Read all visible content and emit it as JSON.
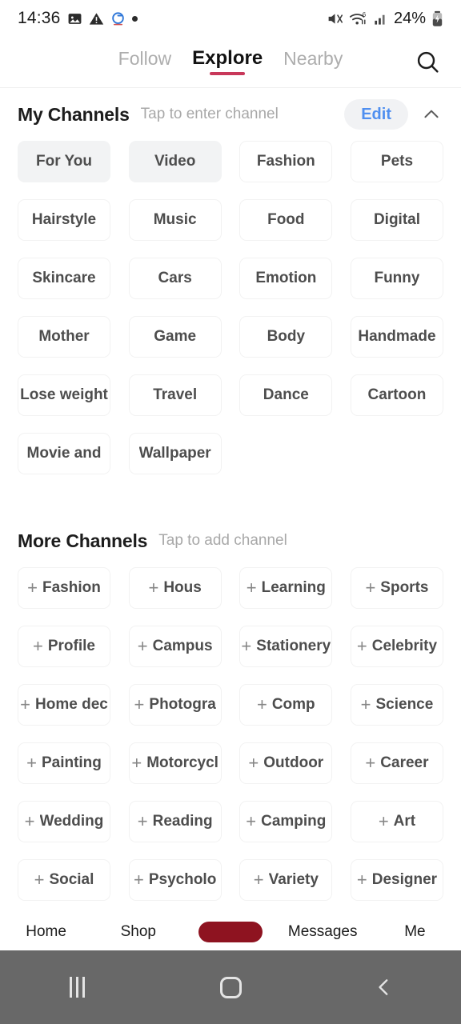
{
  "status_bar": {
    "time": "14:36",
    "battery_percent": "24%",
    "left_icons": [
      "image-icon",
      "warning-icon",
      "sync-icon",
      "dot-icon"
    ],
    "right_icons": [
      "volume-mute-icon",
      "wifi-icon",
      "signal-icon",
      "battery-charging-icon"
    ]
  },
  "top_nav": {
    "tabs": [
      {
        "label": "Follow",
        "active": false
      },
      {
        "label": "Explore",
        "active": true
      },
      {
        "label": "Nearby",
        "active": false
      }
    ],
    "search_icon": "search-icon",
    "active_underline_color": "#c8385a"
  },
  "my_channels": {
    "title": "My Channels",
    "subtitle": "Tap to enter channel",
    "edit_label": "Edit",
    "edit_color": "#4f8ff0",
    "collapse_icon": "chevron-up-icon",
    "items": [
      {
        "label": "For You",
        "selected": true
      },
      {
        "label": "Video",
        "selected": true
      },
      {
        "label": "Fashion",
        "selected": false
      },
      {
        "label": "Pets",
        "selected": false
      },
      {
        "label": "Hairstyle",
        "selected": false
      },
      {
        "label": "Music",
        "selected": false
      },
      {
        "label": "Food",
        "selected": false
      },
      {
        "label": "Digital",
        "selected": false
      },
      {
        "label": "Skincare",
        "selected": false
      },
      {
        "label": "Cars",
        "selected": false
      },
      {
        "label": "Emotion",
        "selected": false
      },
      {
        "label": "Funny",
        "selected": false
      },
      {
        "label": "Mother",
        "selected": false
      },
      {
        "label": "Game",
        "selected": false
      },
      {
        "label": "Body",
        "selected": false
      },
      {
        "label": "Handmade",
        "selected": false
      },
      {
        "label": "Lose weight",
        "selected": false
      },
      {
        "label": "Travel",
        "selected": false
      },
      {
        "label": "Dance",
        "selected": false
      },
      {
        "label": "Cartoon",
        "selected": false
      },
      {
        "label": "Movie and",
        "selected": false
      },
      {
        "label": "Wallpaper",
        "selected": false
      }
    ]
  },
  "more_channels": {
    "title": "More Channels",
    "subtitle": "Tap to add channel",
    "add_icon": "plus-icon",
    "items": [
      {
        "label": "Fashion"
      },
      {
        "label": "Hous"
      },
      {
        "label": "Learning"
      },
      {
        "label": "Sports"
      },
      {
        "label": "Profile"
      },
      {
        "label": "Campus"
      },
      {
        "label": "Stationery"
      },
      {
        "label": "Celebrity"
      },
      {
        "label": "Home dec"
      },
      {
        "label": "Photogra"
      },
      {
        "label": "Comp"
      },
      {
        "label": "Science"
      },
      {
        "label": "Painting"
      },
      {
        "label": "Motorcycl"
      },
      {
        "label": "Outdoor"
      },
      {
        "label": "Career"
      },
      {
        "label": "Wedding"
      },
      {
        "label": "Reading"
      },
      {
        "label": "Camping"
      },
      {
        "label": "Art"
      },
      {
        "label": "Social"
      },
      {
        "label": "Psycholo"
      },
      {
        "label": "Variety"
      },
      {
        "label": "Designer"
      }
    ]
  },
  "bottom_nav": {
    "items": [
      {
        "label": "Home",
        "type": "text"
      },
      {
        "label": "Shop",
        "type": "text"
      },
      {
        "label": "",
        "type": "post-button"
      },
      {
        "label": "Messages",
        "type": "text"
      },
      {
        "label": "Me",
        "type": "text"
      }
    ],
    "post_button_color": "#8e1320"
  },
  "system_nav": {
    "buttons": [
      "recents-icon",
      "home-icon",
      "back-icon"
    ]
  }
}
